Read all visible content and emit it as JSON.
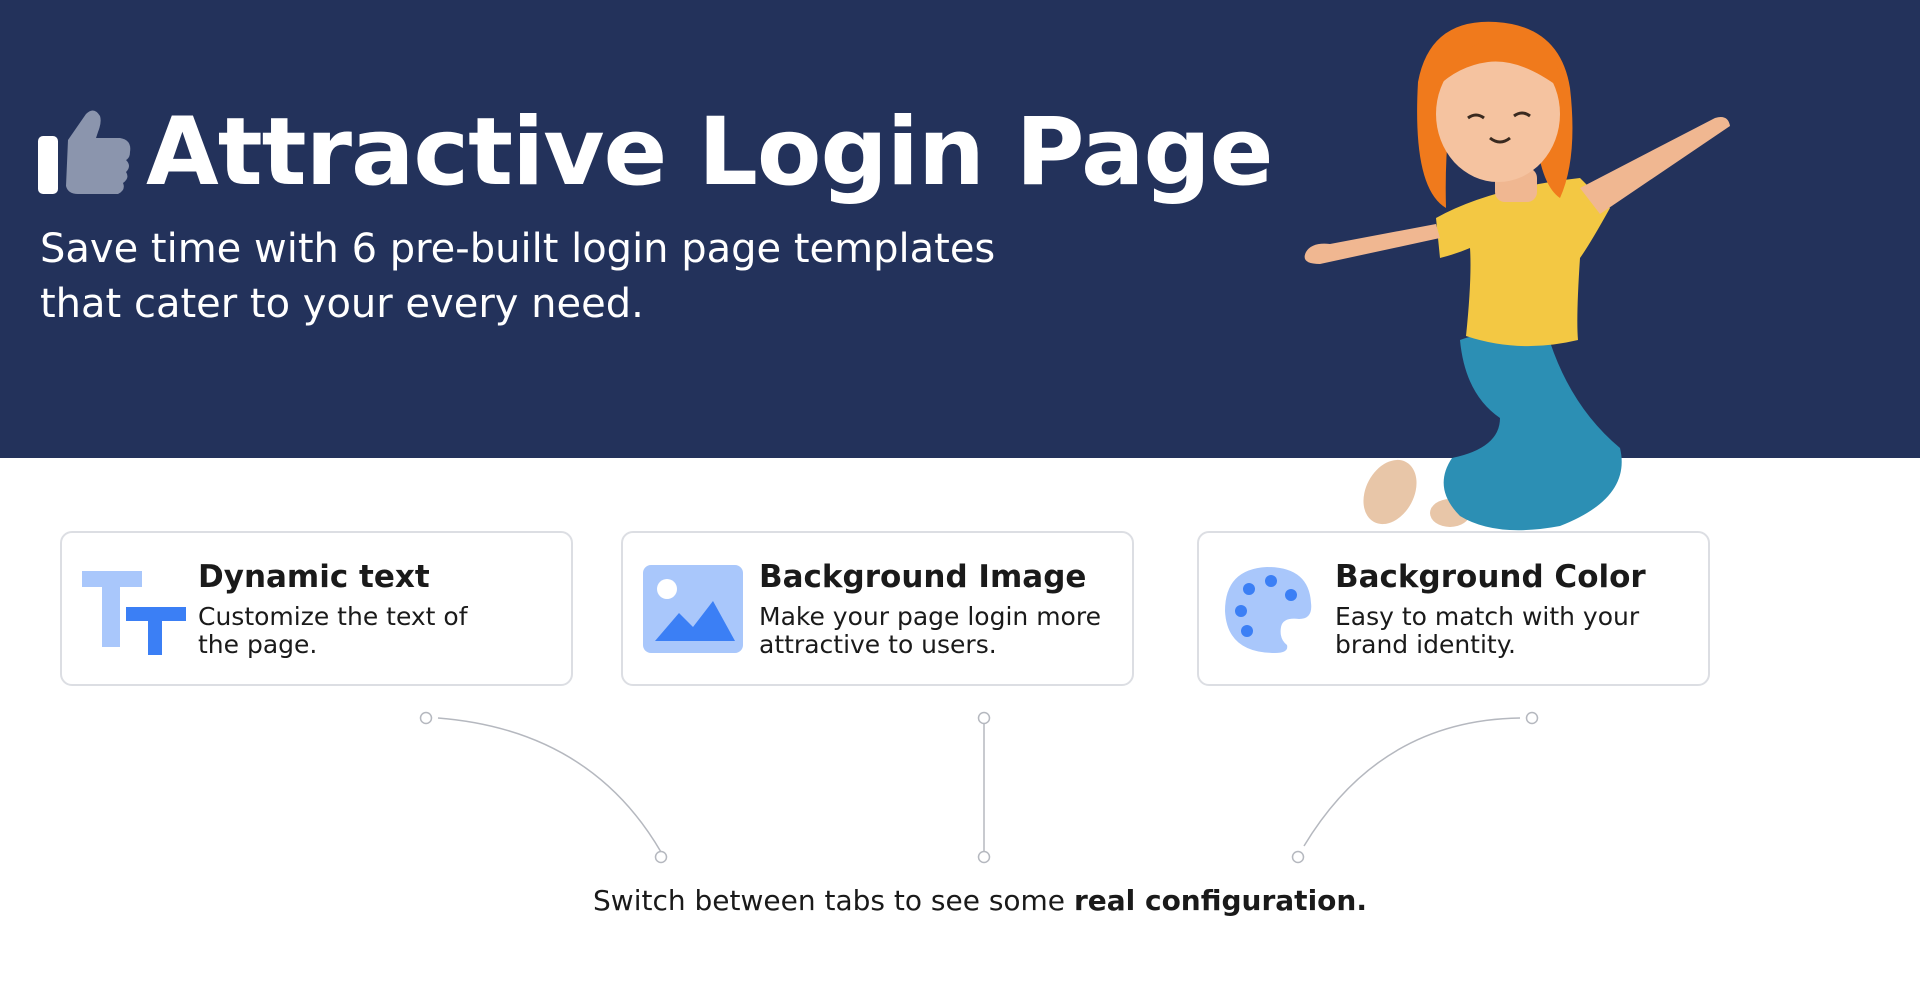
{
  "hero": {
    "title": "Attractive Login Page",
    "subtitle_line1": "Save time with 6 pre-built login page templates",
    "subtitle_line2": "that cater to your every need.",
    "title_icon": "thumbs-up-icon",
    "illustration": "jumping-girl-illustration"
  },
  "features": [
    {
      "title": "Dynamic text",
      "line1": "Customize the text of",
      "line2": "the page.",
      "icon": "text-icon"
    },
    {
      "title": "Background Image",
      "line1": "Make your page login more",
      "line2": "attractive to users.",
      "icon": "image-icon"
    },
    {
      "title": "Background Color",
      "line1": "Easy to match with your",
      "line2": "brand identity.",
      "icon": "palette-icon"
    }
  ],
  "footer": {
    "text": "Switch between tabs to see some ",
    "bold_text": "real configuration."
  },
  "colors": {
    "hero_background": "#23325b",
    "accent_blue": "#3b7ff5",
    "accent_light_blue": "#a9c7fb",
    "card_border": "#dcdee3",
    "connector_line": "#b5b8bf"
  }
}
